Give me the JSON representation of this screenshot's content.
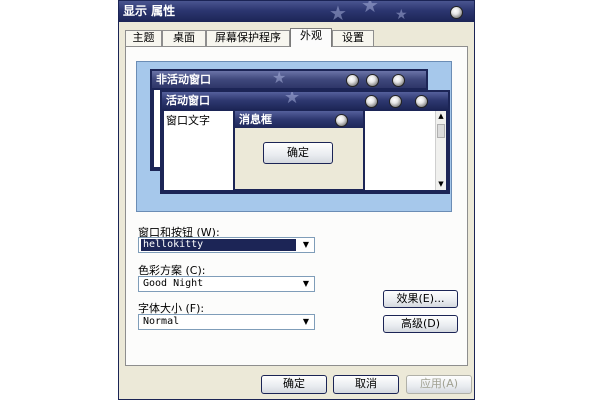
{
  "window": {
    "title": "显示 属性"
  },
  "tabs": [
    {
      "label": "主题"
    },
    {
      "label": "桌面"
    },
    {
      "label": "屏幕保护程序"
    },
    {
      "label": "外观",
      "active": true
    },
    {
      "label": "设置"
    }
  ],
  "preview": {
    "inactive_title": "非活动窗口",
    "active_title": "活动窗口",
    "window_text": "窗口文字",
    "message_title": "消息框",
    "message_ok": "确定"
  },
  "fields": {
    "windows_buttons": {
      "label": "窗口和按钮 (W):",
      "value": "hellokitty"
    },
    "color_scheme": {
      "label": "色彩方案 (C):",
      "value": "Good Night"
    },
    "font_size": {
      "label": "字体大小 (F):",
      "value": "Normal"
    }
  },
  "buttons": {
    "effects": "效果(E)...",
    "advanced": "高级(D)",
    "ok": "确定",
    "cancel": "取消",
    "apply": "应用(A)"
  },
  "colors": {
    "theme_dark": "#1c2556",
    "dialog_bg": "#ece9d8",
    "preview_bg": "#a6c8eb"
  },
  "icons": [
    "title-orb-icon",
    "star-decoration-icon",
    "dropdown-arrow-icon",
    "scroll-up-icon",
    "scroll-down-icon"
  ]
}
